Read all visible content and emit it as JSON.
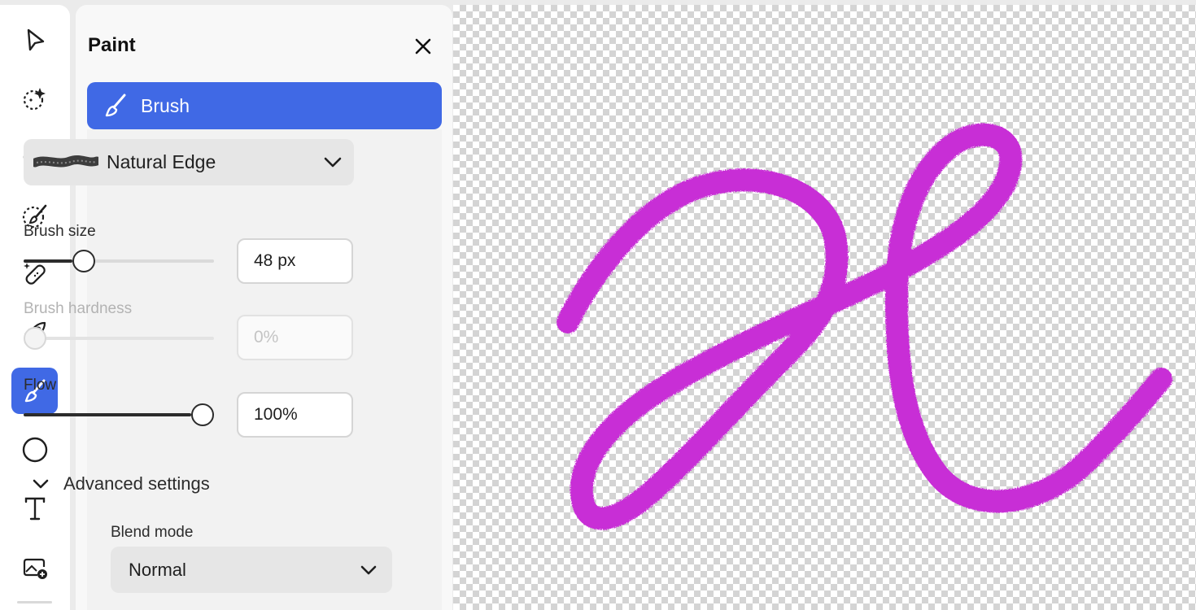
{
  "toolbar": {
    "tools": [
      {
        "name": "select-tool",
        "icon": "cursor-arrow-icon",
        "active": false
      },
      {
        "name": "quick-actions-tool",
        "icon": "sparkle-select-icon",
        "active": false
      },
      {
        "name": "adjustments-tool",
        "icon": "contrast-icon",
        "active": false
      },
      {
        "name": "selection-brush-tool",
        "icon": "brush-selection-icon",
        "active": false
      },
      {
        "name": "retouch-tool",
        "icon": "bandage-icon",
        "active": false
      },
      {
        "name": "generative-tool",
        "icon": "rocket-icon",
        "active": false
      },
      {
        "name": "paint-tool",
        "icon": "paintbrush-icon",
        "active": true
      },
      {
        "name": "shape-tool",
        "icon": "circle-icon",
        "active": false
      },
      {
        "name": "text-tool",
        "icon": "text-icon",
        "active": false
      },
      {
        "name": "add-image-tool",
        "icon": "add-image-icon",
        "active": false
      }
    ]
  },
  "panel": {
    "title": "Paint",
    "brush_tab_label": "Brush",
    "preset": "Natural Edge",
    "brush_size": {
      "label": "Brush size",
      "value": "48 px",
      "fraction": 0.29
    },
    "brush_hardness": {
      "label": "Brush hardness",
      "value": "0%",
      "fraction": 0.0,
      "disabled": true
    },
    "flow": {
      "label": "Flow",
      "value": "100%",
      "fraction": 1.0
    },
    "advanced_label": "Advanced settings",
    "blend_mode": {
      "label": "Blend mode",
      "value": "Normal"
    }
  },
  "colors": {
    "accent": "#4069e5",
    "stroke": "#c82fd6"
  }
}
